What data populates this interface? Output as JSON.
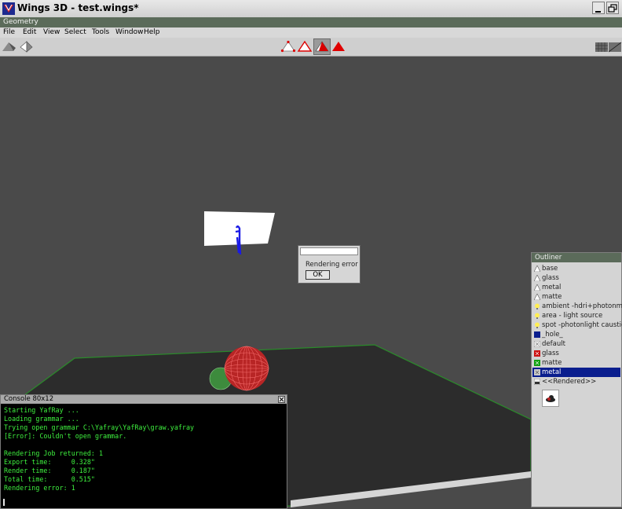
{
  "window": {
    "title": "Wings 3D - test.wings*"
  },
  "geometry_label": "Geometry",
  "menu": [
    "File",
    "Edit",
    "View",
    "Select",
    "Tools",
    "Window",
    "Help"
  ],
  "toolbar": {
    "left_icons": [
      "smooth-shading-icon",
      "flat-shading-icon"
    ],
    "mode_icons": [
      "vertex-mode-icon",
      "edge-mode-icon",
      "face-mode-icon",
      "body-mode-icon"
    ],
    "right_icon": "grid-icon"
  },
  "dialog": {
    "message": "Rendering error",
    "ok_label": "OK"
  },
  "outliner": {
    "title": "Outliner",
    "items": [
      {
        "label": "base",
        "icon": "light-icon",
        "color": "#ffffff"
      },
      {
        "label": "glass",
        "icon": "light-icon",
        "color": "#ffffff"
      },
      {
        "label": "metal",
        "icon": "light-icon",
        "color": "#ffffff"
      },
      {
        "label": "matte",
        "icon": "light-icon",
        "color": "#ffffff"
      },
      {
        "label": "ambient -hdri+photonmap",
        "icon": "bulb-icon",
        "color": "#ffee55"
      },
      {
        "label": "area - light source",
        "icon": "bulb-icon",
        "color": "#ffee55"
      },
      {
        "label": "spot -photonlight caustic",
        "icon": "bulb-icon",
        "color": "#ffee55"
      },
      {
        "label": "_hole_",
        "icon": "material-icon",
        "color": "#0a1e8e"
      },
      {
        "label": "default",
        "icon": "material-icon",
        "color": "#f0f0f0"
      },
      {
        "label": "glass",
        "icon": "material-icon",
        "color": "#cc1010"
      },
      {
        "label": "matte",
        "icon": "material-icon",
        "color": "#10a010"
      },
      {
        "label": "metal",
        "icon": "material-icon",
        "color": "#c8c8c8",
        "selected": true
      },
      {
        "label": "<<Rendered>>",
        "icon": "image-icon",
        "color": "#888888"
      }
    ]
  },
  "console": {
    "title": "Console 80x12",
    "lines": [
      "Starting YafRay ...",
      "Loading grammar ...",
      "Trying open grammar C:\\Yafray\\YafRay\\graw.yafray",
      "[Error]: Couldn't open grammar.",
      "",
      "Rendering Job returned: 1",
      "Export time:     0.328\"",
      "Render time:     0.187\"",
      "Total time:      0.515\"",
      "Rendering error: 1"
    ]
  }
}
